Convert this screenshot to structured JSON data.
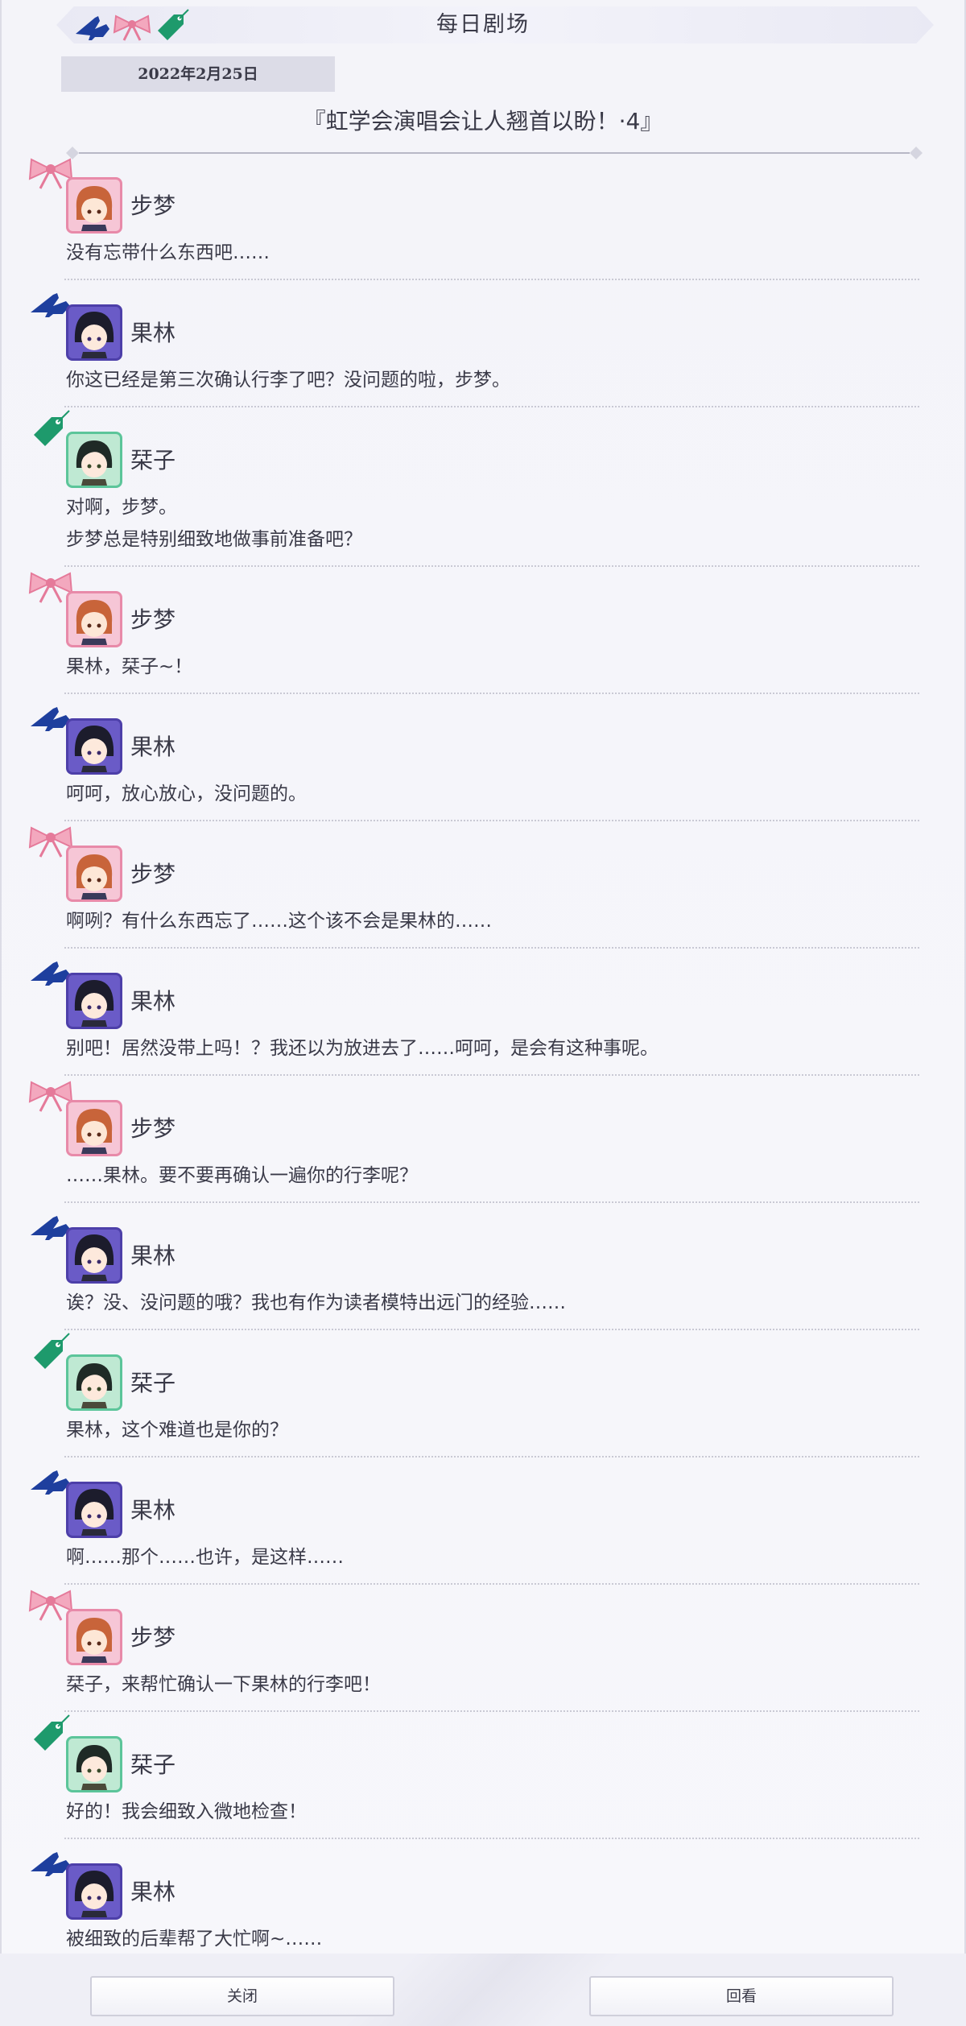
{
  "header": {
    "title": "每日剧场"
  },
  "date": "2022年2月25日",
  "episode_title": "『虹学会演唱会让人翘首以盼！·4』",
  "colors": {
    "bow": "#e57a9a",
    "heel": "#1e3f9e",
    "tag": "#1e9a6c"
  },
  "dialogue": [
    {
      "speaker": "步梦",
      "emblem": "bow-icon",
      "lines": [
        "没有忘带什么东西吧……"
      ]
    },
    {
      "speaker": "果林",
      "emblem": "high-heel-icon",
      "lines": [
        "你这已经是第三次确认行李了吧？没问题的啦，步梦。"
      ]
    },
    {
      "speaker": "栞子",
      "emblem": "tag-icon",
      "lines": [
        "对啊，步梦。",
        "步梦总是特别细致地做事前准备吧？"
      ]
    },
    {
      "speaker": "步梦",
      "emblem": "bow-icon",
      "lines": [
        "果林，栞子~！"
      ]
    },
    {
      "speaker": "果林",
      "emblem": "high-heel-icon",
      "lines": [
        "呵呵，放心放心，没问题的。"
      ]
    },
    {
      "speaker": "步梦",
      "emblem": "bow-icon",
      "lines": [
        "啊咧？有什么东西忘了……这个该不会是果林的……"
      ]
    },
    {
      "speaker": "果林",
      "emblem": "high-heel-icon",
      "lines": [
        "别吧！居然没带上吗！？我还以为放进去了……呵呵，是会有这种事呢。"
      ]
    },
    {
      "speaker": "步梦",
      "emblem": "bow-icon",
      "lines": [
        "……果林。要不要再确认一遍你的行李呢？"
      ]
    },
    {
      "speaker": "果林",
      "emblem": "high-heel-icon",
      "lines": [
        "诶？没、没问题的哦？我也有作为读者模特出远门的经验……"
      ]
    },
    {
      "speaker": "栞子",
      "emblem": "tag-icon",
      "lines": [
        "果林，这个难道也是你的？"
      ]
    },
    {
      "speaker": "果林",
      "emblem": "high-heel-icon",
      "lines": [
        "啊……那个……也许，是这样……"
      ]
    },
    {
      "speaker": "步梦",
      "emblem": "bow-icon",
      "lines": [
        "栞子，来帮忙确认一下果林的行李吧！"
      ]
    },
    {
      "speaker": "栞子",
      "emblem": "tag-icon",
      "lines": [
        "好的！我会细致入微地检查！"
      ]
    },
    {
      "speaker": "果林",
      "emblem": "high-heel-icon",
      "lines": [
        "被细致的后辈帮了大忙啊~……"
      ]
    }
  ],
  "buttons": {
    "close": "关闭",
    "replay": "回看"
  }
}
